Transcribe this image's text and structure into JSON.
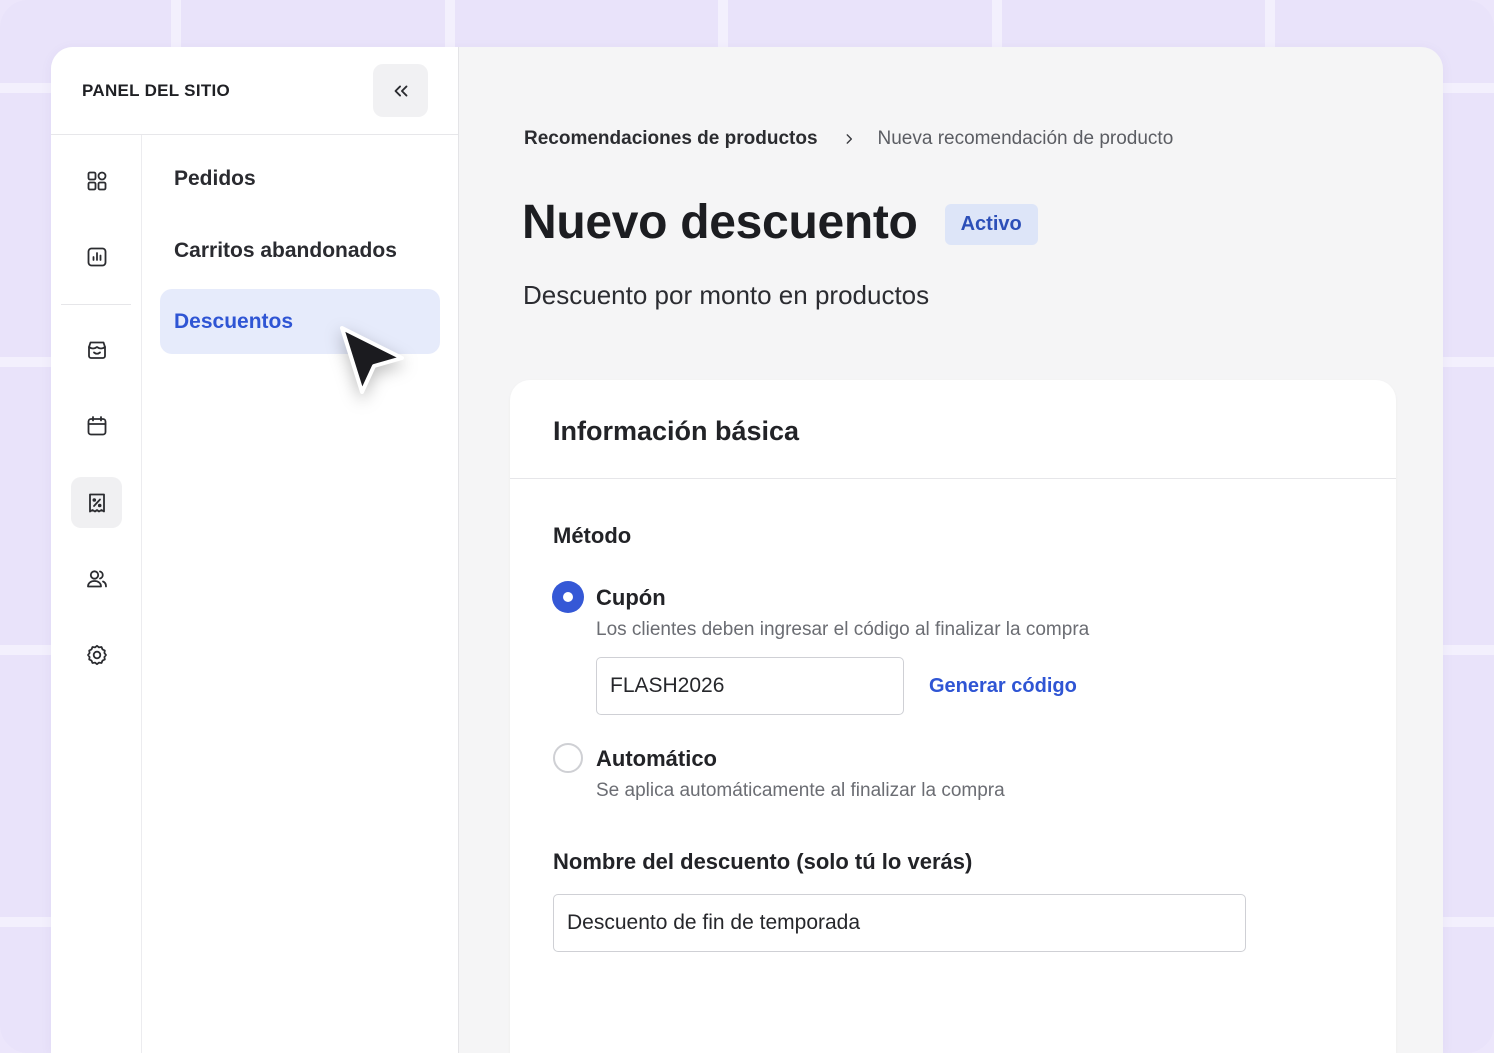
{
  "sidebar": {
    "title": "PANEL DEL SITIO",
    "rail_icons": [
      "dashboard-icon",
      "analytics-icon",
      "store-icon",
      "calendar-icon",
      "discount-icon",
      "users-icon",
      "settings-icon"
    ],
    "items": [
      {
        "label": "Pedidos"
      },
      {
        "label": "Carritos abandonados"
      },
      {
        "label": "Descuentos"
      }
    ]
  },
  "breadcrumb": {
    "parent": "Recomendaciones de productos",
    "current": "Nueva recomendación de producto"
  },
  "page": {
    "title": "Nuevo descuento",
    "status": "Activo",
    "subtitle": "Descuento por monto en productos"
  },
  "card": {
    "title": "Información básica",
    "method_label": "Método",
    "options": [
      {
        "label": "Cupón",
        "description": "Los clientes deben ingresar el código al finalizar la compra",
        "selected": true
      },
      {
        "label": "Automático",
        "description": "Se aplica automáticamente al finalizar la compra",
        "selected": false
      }
    ],
    "code_value": "FLASH2026",
    "generate_label": "Generar código",
    "name_label": "Nombre del descuento (solo tú lo verás)",
    "name_value": "Descuento de fin de temporada"
  },
  "colors": {
    "accent": "#2f55d4",
    "active_bg": "#e6ebfb",
    "badge_bg": "#dde5f8"
  }
}
